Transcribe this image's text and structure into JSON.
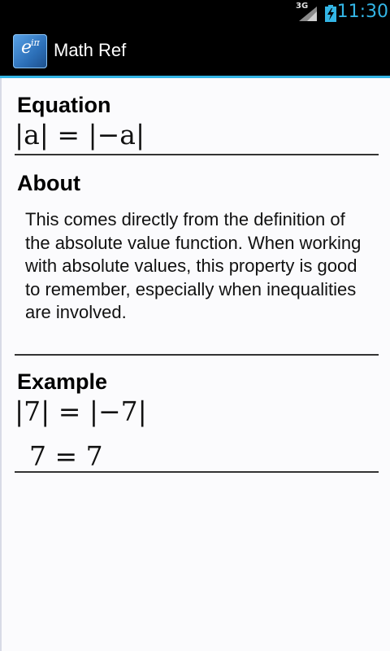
{
  "status_bar": {
    "network": "3G",
    "time": "11:30",
    "accent_color": "#33b5e5"
  },
  "action_bar": {
    "app_icon_base": "e",
    "app_icon_exponent": "iπ",
    "title": "Math Ref"
  },
  "equation": {
    "heading": "Equation",
    "formula": "|a| = |−a|"
  },
  "about": {
    "heading": "About",
    "text": "This comes directly from the definition of the absolute value function. When working with absolute values, this property is good to remember, especially when inequalities are involved."
  },
  "example": {
    "heading": "Example",
    "line1": "|7| = |−7|",
    "line2": "7 = 7"
  }
}
